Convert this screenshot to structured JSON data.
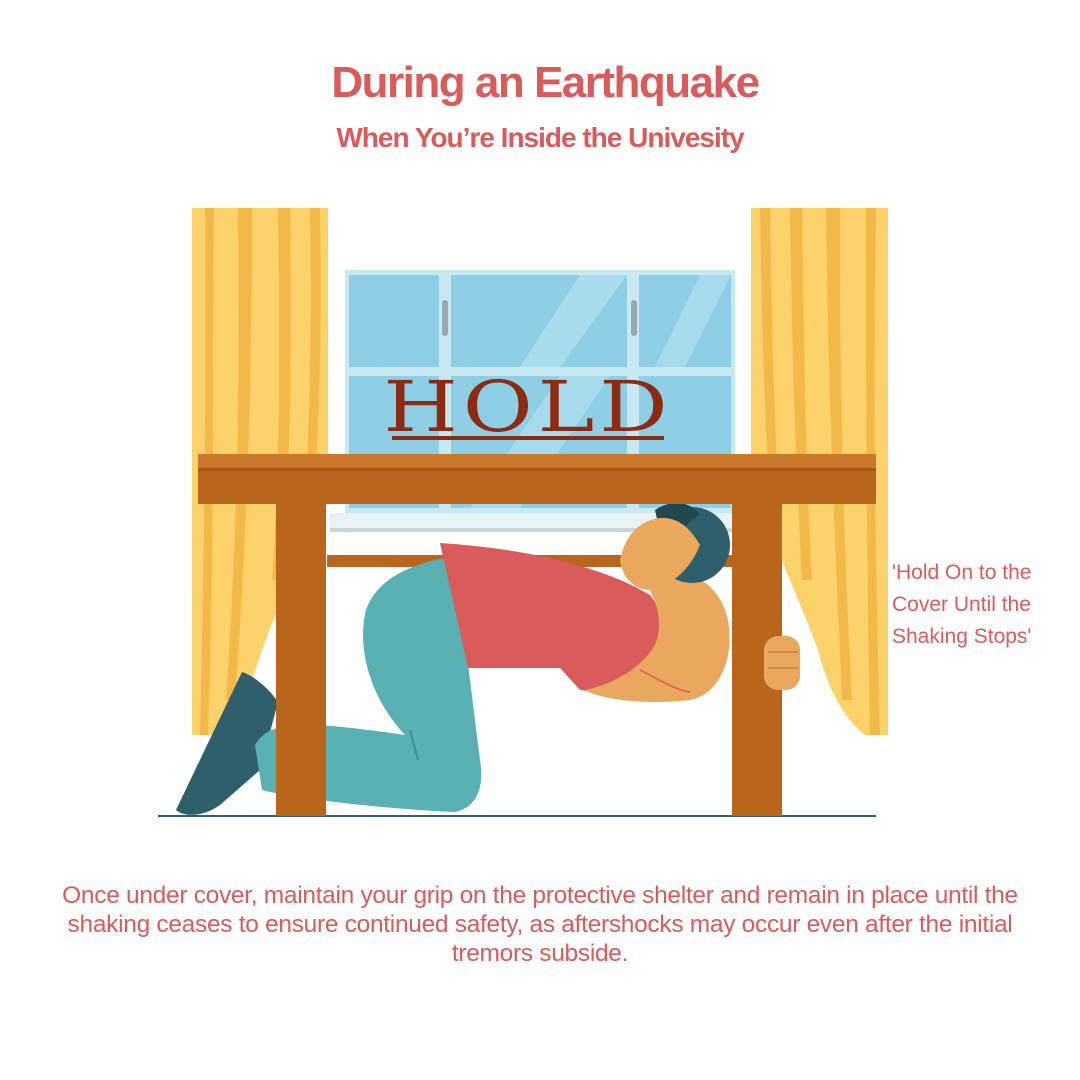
{
  "header": {
    "title": "During an Earthquake",
    "subtitle": "When You’re Inside the Univesity"
  },
  "illustration": {
    "sign_text": "HOLD",
    "icons": [
      "curtain-left",
      "curtain-right",
      "window",
      "table",
      "person-taking-cover"
    ],
    "colors": {
      "text": "#d95b5b",
      "sign": "#8c2a12",
      "curtain": "#fcd26b",
      "glass": "#8ecfe6",
      "table": "#b9651c",
      "shirt": "#d95b5b",
      "pants": "#5ab1b3",
      "skin": "#eaa85f",
      "hair": "#2e5f6a"
    }
  },
  "side_note": {
    "lines": [
      "'Hold On to the",
      "Cover Until the",
      "Shaking Stops'"
    ]
  },
  "caption": {
    "text": "Once under cover, maintain your grip on the protective shelter and remain in place until the shaking ceases to ensure continued safety, as aftershocks may occur even after the initial tremors subside."
  }
}
